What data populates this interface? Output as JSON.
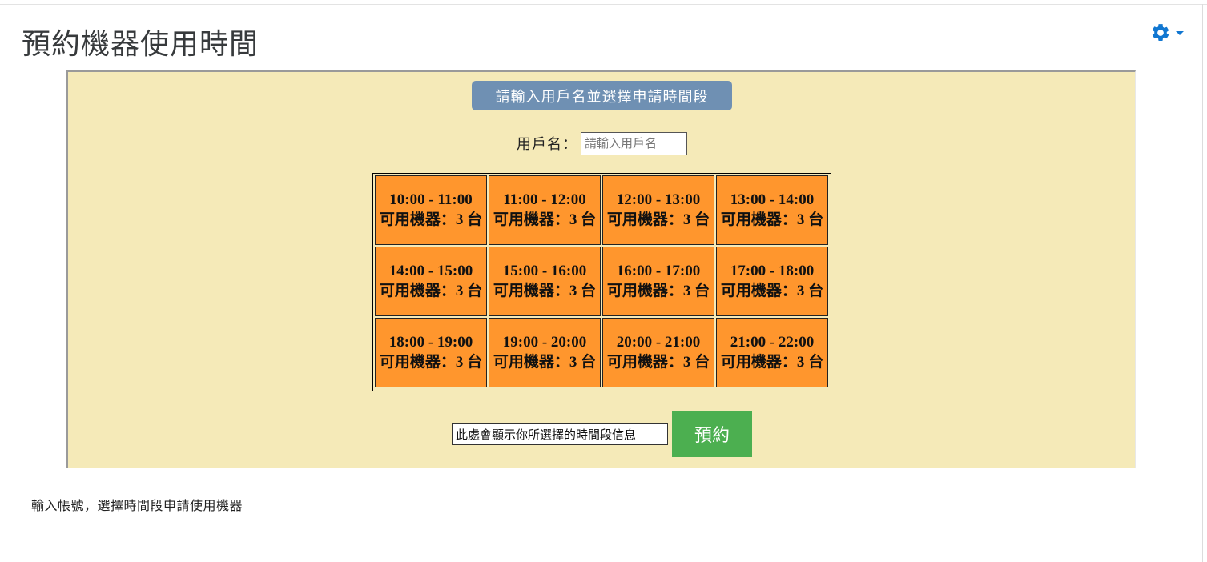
{
  "page": {
    "title": "預約機器使用時間",
    "footer_text": "輸入帳號，選擇時間段申請使用機器"
  },
  "header": {
    "settings_icon": "gear-icon",
    "accent_color": "#1177d1"
  },
  "form": {
    "instruction": "請輸入用戶名並選擇申請時間段",
    "user_label": "用戶名：",
    "user_placeholder": "請輸入用戶名",
    "selection_value": "此處會顯示你所選擇的時間段信息",
    "reserve_label": "預約"
  },
  "slots": [
    {
      "time": "10:00 - 11:00",
      "availability": "可用機器：3 台"
    },
    {
      "time": "11:00 - 12:00",
      "availability": "可用機器：3 台"
    },
    {
      "time": "12:00 - 13:00",
      "availability": "可用機器：3 台"
    },
    {
      "time": "13:00 - 14:00",
      "availability": "可用機器：3 台"
    },
    {
      "time": "14:00 - 15:00",
      "availability": "可用機器：3 台"
    },
    {
      "time": "15:00 - 16:00",
      "availability": "可用機器：3 台"
    },
    {
      "time": "16:00 - 17:00",
      "availability": "可用機器：3 台"
    },
    {
      "time": "17:00 - 18:00",
      "availability": "可用機器：3 台"
    },
    {
      "time": "18:00 - 19:00",
      "availability": "可用機器：3 台"
    },
    {
      "time": "19:00 - 20:00",
      "availability": "可用機器：3 台"
    },
    {
      "time": "20:00 - 21:00",
      "availability": "可用機器：3 台"
    },
    {
      "time": "21:00 - 22:00",
      "availability": "可用機器：3 台"
    }
  ],
  "colors": {
    "panel_background": "#f5eab8",
    "slot_background": "#ff962d",
    "instruction_background": "#6f90b3",
    "reserve_button": "#4caf50"
  }
}
